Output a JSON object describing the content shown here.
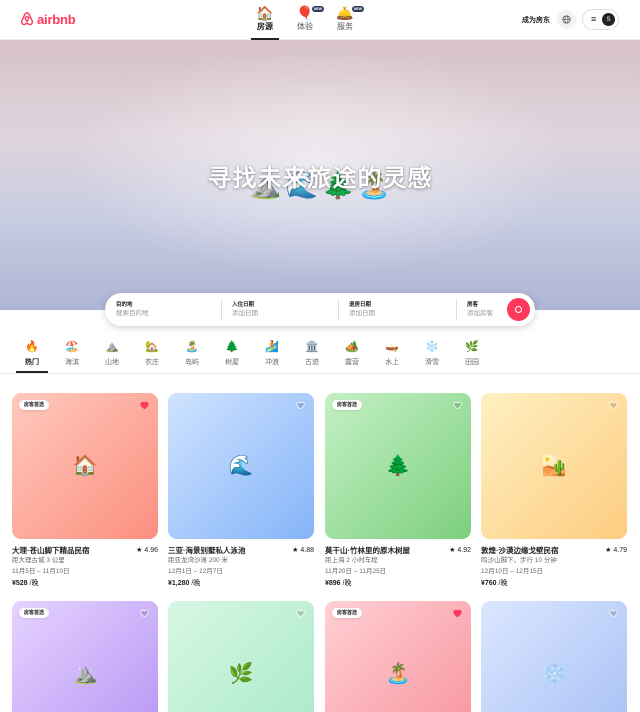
{
  "brand": {
    "name": "airbnb",
    "color": "#ff385c"
  },
  "nav": [
    {
      "label": "房源",
      "emoji": "🏠",
      "badge": "",
      "active": true
    },
    {
      "label": "体验",
      "emoji": "🎈",
      "badge": "NEW",
      "active": false
    },
    {
      "label": "服务",
      "emoji": "🛎️",
      "badge": "NEW",
      "active": false
    }
  ],
  "header": {
    "host_label": "成为房东",
    "globe_icon": "globe-icon",
    "menu_icon": "menu-icon",
    "avatar_letter": "S"
  },
  "hero": {
    "title": "寻找未来旅途的灵感",
    "decorations": [
      "⛰️",
      "🌊",
      "🌲",
      "🏝️"
    ]
  },
  "search": {
    "where_label": "目的地",
    "where_placeholder": "搜索目的地",
    "checkin_label": "入住日期",
    "checkin_placeholder": "添加日期",
    "checkout_label": "退房日期",
    "checkout_placeholder": "添加日期",
    "guests_label": "房客",
    "guests_placeholder": "添加房客",
    "button_icon": "search-icon"
  },
  "categories": [
    {
      "label": "热门",
      "emoji": "🔥",
      "active": true
    },
    {
      "label": "海滨",
      "emoji": "🏖️",
      "active": false
    },
    {
      "label": "山地",
      "emoji": "⛰️",
      "active": false
    },
    {
      "label": "农庄",
      "emoji": "🏡",
      "active": false
    },
    {
      "label": "岛屿",
      "emoji": "🏝️",
      "active": false
    },
    {
      "label": "树屋",
      "emoji": "🌲",
      "active": false
    },
    {
      "label": "冲浪",
      "emoji": "🏄",
      "active": false
    },
    {
      "label": "古迹",
      "emoji": "🏛️",
      "active": false
    },
    {
      "label": "露营",
      "emoji": "🏕️",
      "active": false
    },
    {
      "label": "水上",
      "emoji": "🛶",
      "active": false
    },
    {
      "label": "滑雪",
      "emoji": "❄️",
      "active": false
    },
    {
      "label": "田园",
      "emoji": "🌿",
      "active": false
    }
  ],
  "listings": [
    {
      "title": "大理·苍山脚下精品民宿",
      "rating": "★ 4.96",
      "distance": "距大理古城 3 公里",
      "dates": "11月5日 – 11月10日",
      "price": "¥528",
      "unit": " /晚",
      "badge": "房客首选",
      "favorited": true,
      "emoji": "🏠",
      "gradient": "g-red"
    },
    {
      "title": "三亚·海景别墅私人泳池",
      "rating": "★ 4.88",
      "distance": "距亚龙湾沙滩 200 米",
      "dates": "12月1日 – 12月7日",
      "price": "¥1,280",
      "unit": " /晚",
      "badge": "",
      "favorited": false,
      "emoji": "🌊",
      "gradient": "g-blue"
    },
    {
      "title": "莫干山·竹林里的原木树屋",
      "rating": "★ 4.92",
      "distance": "距上海 2 小时车程",
      "dates": "11月20日 – 11月25日",
      "price": "¥896",
      "unit": " /晚",
      "badge": "房客首选",
      "favorited": false,
      "emoji": "🌲",
      "gradient": "g-green"
    },
    {
      "title": "敦煌·沙漠边缘戈壁民宿",
      "rating": "★ 4.79",
      "distance": "鸣沙山脚下，步行 10 分钟",
      "dates": "12月10日 – 12月15日",
      "price": "¥760",
      "unit": " /晚",
      "badge": "",
      "favorited": false,
      "emoji": "🏜️",
      "gradient": "g-yellow"
    },
    {
      "title": "",
      "rating": "",
      "distance": "",
      "dates": "",
      "price": "",
      "unit": "",
      "badge": "房客首选",
      "favorited": false,
      "emoji": "⛰️",
      "gradient": "g-purple"
    },
    {
      "title": "",
      "rating": "",
      "distance": "",
      "dates": "",
      "price": "",
      "unit": "",
      "badge": "",
      "favorited": false,
      "emoji": "🌿",
      "gradient": "g-mint"
    },
    {
      "title": "",
      "rating": "",
      "distance": "",
      "dates": "",
      "price": "",
      "unit": "",
      "badge": "房客首选",
      "favorited": true,
      "emoji": "🏝️",
      "gradient": "g-pink"
    },
    {
      "title": "",
      "rating": "",
      "distance": "",
      "dates": "",
      "price": "",
      "unit": "",
      "badge": "",
      "favorited": false,
      "emoji": "❄️",
      "gradient": "g-sky"
    }
  ]
}
